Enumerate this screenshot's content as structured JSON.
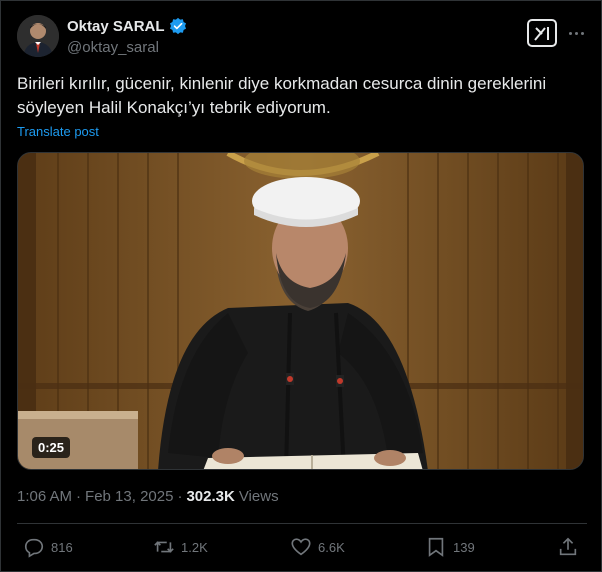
{
  "author": {
    "name": "Oktay SARAL",
    "handle": "@oktay_saral",
    "verified": true
  },
  "header": {
    "grok_icon": "grok-icon",
    "more_icon": "more-dots-icon"
  },
  "tweet": {
    "text": "Birileri kırılır, gücenir, kinlenir diye korkmadan cesurca dinin gereklerini söyleyen Halil Konakçı’yı tebrik ediyorum.",
    "translate_label": "Translate post"
  },
  "media": {
    "type": "video",
    "duration": "0:25"
  },
  "meta": {
    "time": "1:06 AM",
    "separator": "·",
    "date": "Feb 13, 2025",
    "separator2": "·",
    "views_count": "302.3K",
    "views_label": "Views"
  },
  "actions": {
    "replies": "816",
    "reposts": "1.2K",
    "likes": "6.6K",
    "bookmarks": "139"
  },
  "colors": {
    "background": "#000000",
    "text": "#e7e9ea",
    "muted": "#71767b",
    "accent": "#1d9bf0"
  }
}
